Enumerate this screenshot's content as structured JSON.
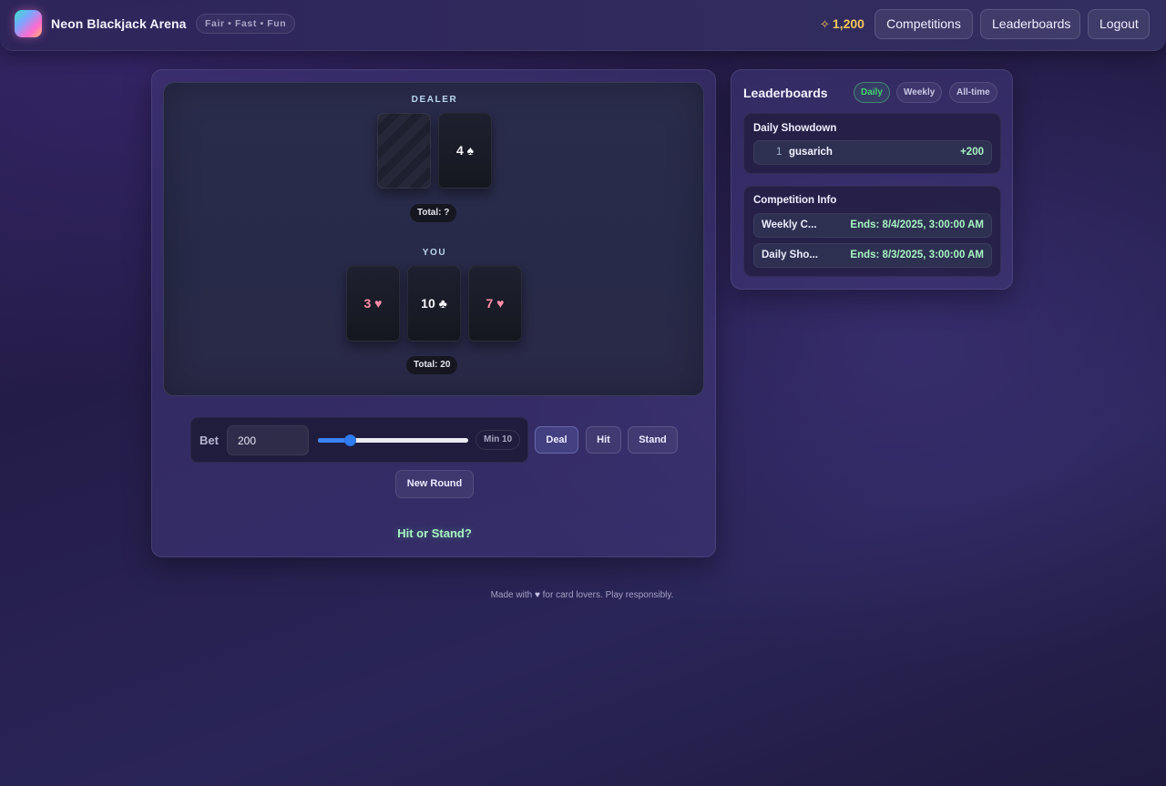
{
  "header": {
    "app_name": "Neon Blackjack Arena",
    "tagline": "Fair • Fast • Fun",
    "coins_icon": "✧",
    "coins": "1,200",
    "nav": {
      "competitions": "Competitions",
      "leaderboards": "Leaderboards",
      "logout": "Logout"
    }
  },
  "game": {
    "dealer": {
      "label": "DEALER",
      "cards": [
        {
          "face": "hidden",
          "rank": "",
          "suit": ""
        },
        {
          "face": "up",
          "rank": "4",
          "suit": "♠",
          "text": "4 ♠",
          "color": "#f6f6fa"
        }
      ],
      "total": "Total: ?"
    },
    "player": {
      "label": "YOU",
      "cards": [
        {
          "rank": "3",
          "suit": "♥",
          "text": "3 ♥",
          "color": "#ff8ea8"
        },
        {
          "rank": "10",
          "suit": "♣",
          "text": "10 ♣",
          "color": "#f6f6fa"
        },
        {
          "rank": "7",
          "suit": "♥",
          "text": "7 ♥",
          "color": "#ff8ea8"
        }
      ],
      "total": "Total: 20"
    },
    "controls": {
      "bet_label": "Bet",
      "bet_value": "200",
      "slider_fraction": 0.19,
      "min_label": "Min 10",
      "deal": "Deal",
      "hit": "Hit",
      "stand": "Stand",
      "new_round": "New Round"
    },
    "status": "Hit or Stand?"
  },
  "leaderboard": {
    "title": "Leaderboards",
    "tabs": [
      "Daily",
      "Weekly",
      "All-time"
    ],
    "active_tab": "Daily",
    "board_title": "Daily Showdown",
    "entries": [
      {
        "rank": "1",
        "player": "gusarich",
        "score": "+200"
      }
    ],
    "competition_info": {
      "title": "Competition Info",
      "items": [
        {
          "name": "Weekly C...",
          "ends": "Ends: 8/4/2025, 3:00:00 AM"
        },
        {
          "name": "Daily Sho...",
          "ends": "Ends: 8/3/2025, 3:00:00 AM"
        }
      ]
    }
  },
  "footer": {
    "text_before": "Made with",
    "heart": "♥",
    "text_after": "for card lovers. Play responsibly."
  },
  "colors": {
    "accent_green": "#a7f4c2",
    "coins": "#f7c85a",
    "slider": "#3b82f6",
    "red_suit": "#ff8ea8"
  }
}
